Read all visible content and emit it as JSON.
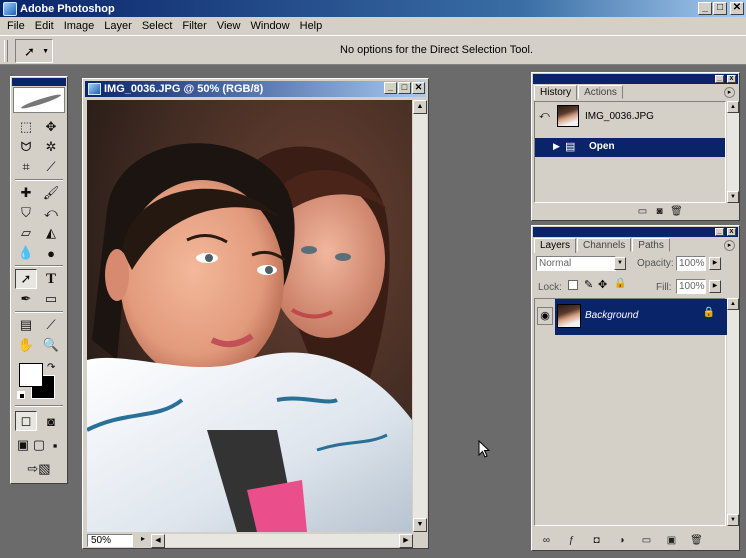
{
  "app": {
    "title": "Adobe Photoshop"
  },
  "window_buttons": {
    "minimize": "_",
    "maximize": "□",
    "close": "✕"
  },
  "menu": [
    "File",
    "Edit",
    "Image",
    "Layer",
    "Select",
    "Filter",
    "View",
    "Window",
    "Help"
  ],
  "options_bar": {
    "message": "No options for the Direct Selection Tool."
  },
  "document": {
    "title": "IMG_0036.JPG @ 50% (RGB/8)",
    "zoom": "50%"
  },
  "history_panel": {
    "tabs": [
      "History",
      "Actions"
    ],
    "snapshot_label": "IMG_0036.JPG",
    "items": [
      "Open"
    ]
  },
  "layers_panel": {
    "tabs": [
      "Layers",
      "Channels",
      "Paths"
    ],
    "blend_mode": "Normal",
    "opacity_label": "Opacity:",
    "opacity_value": "100%",
    "lock_label": "Lock:",
    "fill_label": "Fill:",
    "fill_value": "100%",
    "layers": [
      {
        "name": "Background"
      }
    ]
  },
  "colors": {
    "accent": "#0a246a",
    "chrome": "#d4d0c8",
    "workspace": "#6b6b6b"
  }
}
